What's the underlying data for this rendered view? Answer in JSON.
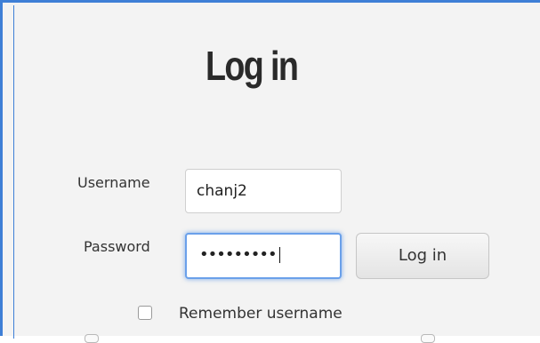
{
  "login": {
    "title": "Log in",
    "username_label": "Username",
    "username_value": "chanj2",
    "password_label": "Password",
    "password_masked": "•••••••••",
    "submit_label": "Log in",
    "remember_label": "Remember username",
    "remember_checked": false
  },
  "colors": {
    "frame_border": "#3e7fd6",
    "background": "#f3f3f3",
    "focus_ring": "#6aa0ea"
  }
}
